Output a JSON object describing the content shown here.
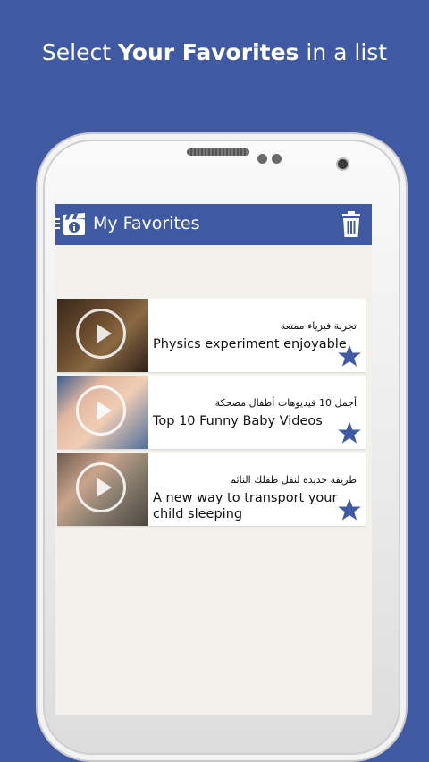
{
  "headline": {
    "pre": "Select ",
    "bold": "Your Favorites",
    "post": " in a list"
  },
  "app": {
    "title": "My Favorites"
  },
  "favorites": [
    {
      "title_ar": "تجربة فيزياء ممتعة",
      "title_en": "Physics experiment enjoyable"
    },
    {
      "title_ar": "أجمل 10 فيديوهات أطفال مضحكة",
      "title_en": "Top 10 Funny Baby Videos"
    },
    {
      "title_ar": "طريقة جديدة لنقل طفلك النائم",
      "title_en": "A new way to transport your child sleeping"
    }
  ],
  "colors": {
    "brand": "#3f5aa3",
    "star": "#3f5aa3"
  }
}
